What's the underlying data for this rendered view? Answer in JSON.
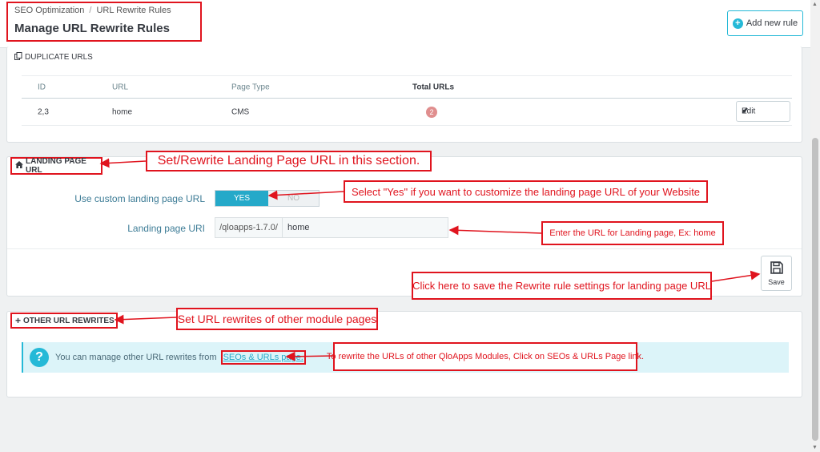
{
  "header": {
    "breadcrumb": [
      "SEO Optimization",
      "/",
      "URL Rewrite Rules"
    ],
    "title": "Manage URL Rewrite Rules",
    "add_button_label": "Add new rule"
  },
  "duplicate_panel": {
    "title": "DUPLICATE URLS",
    "columns": [
      "ID",
      "URL",
      "Page Type",
      "Total URLs"
    ],
    "rows": [
      {
        "id": "2,3",
        "url": "home",
        "page_type": "CMS",
        "total": "2"
      }
    ],
    "edit_label": "Edit"
  },
  "landing_panel": {
    "title": "LANDING PAGE URL",
    "custom_label": "Use custom landing page URL",
    "toggle_yes": "YES",
    "toggle_no": "NO",
    "uri_label": "Landing page URI",
    "uri_prefix": "/qloapps-1.7.0/",
    "uri_value": "home",
    "save_label": "Save"
  },
  "other_panel": {
    "title": "OTHER URL REWRITES",
    "info_text": "You can manage other URL rewrites from",
    "info_link": "SEOs & URLs page."
  },
  "annotations": {
    "landing": "Set/Rewrite Landing Page URL in this section.",
    "yes": "Select \"Yes\" if you want to customize the landing page URL of your Website",
    "uri": "Enter the URL for Landing page,  Ex: home",
    "save": "Click here to save the Rewrite rule settings for landing page URL",
    "other": "Set URL rewrites of other module pages",
    "link": "To rewrite the URLs of other QloApps Modules, Click on SEOs & URLs Page link."
  },
  "colors": {
    "accent": "#25b9d7",
    "annotation_red": "#e0141e",
    "badge": "#e08e8e"
  }
}
